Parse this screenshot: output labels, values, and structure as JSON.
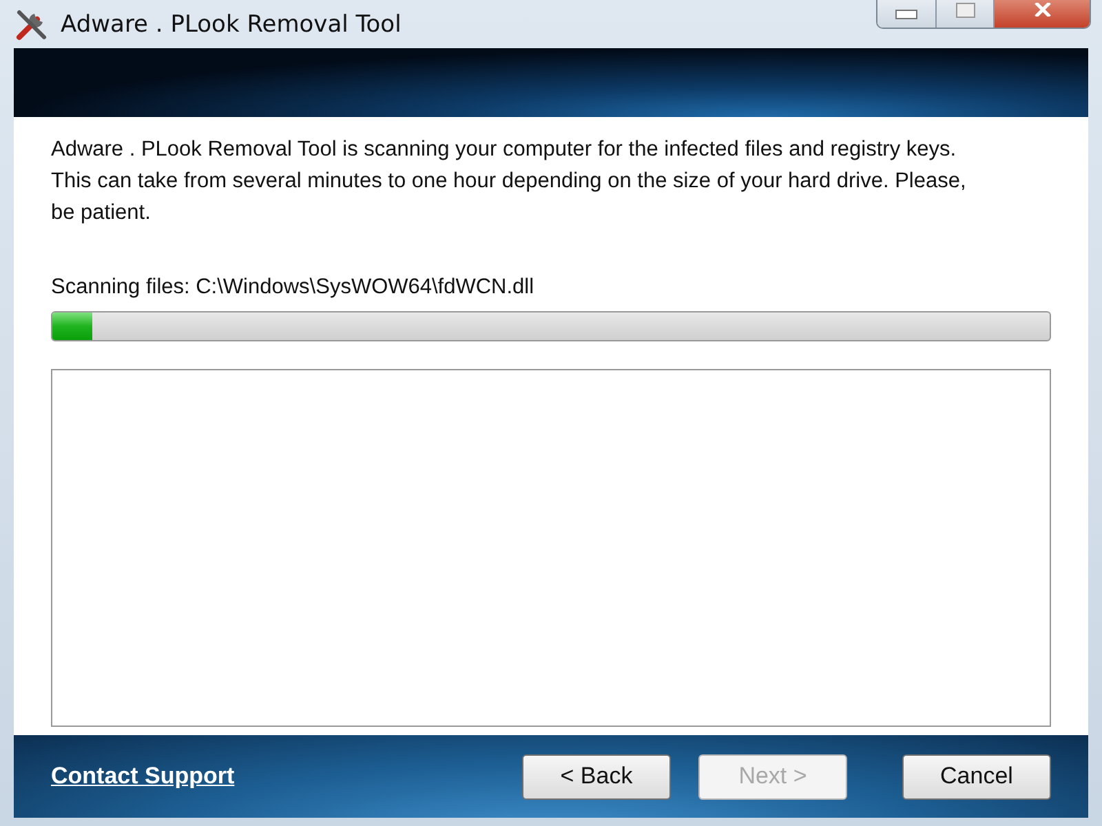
{
  "window": {
    "title": "Adware . PLook Removal Tool"
  },
  "description": "Adware . PLook Removal Tool is scanning your computer for the infected files and registry keys. This can take from several minutes to one hour depending on the size of your hard drive. Please, be patient.",
  "scan": {
    "status": "Scanning files: C:\\Windows\\SysWOW64\\fdWCN.dll",
    "level": 0.04
  },
  "footer": {
    "link": "Contact Support",
    "buttons": [
      {
        "label": "< Back",
        "disabled": false
      },
      {
        "label": "Next >",
        "disabled": true
      },
      {
        "label": "Cancel",
        "disabled": false
      }
    ]
  }
}
